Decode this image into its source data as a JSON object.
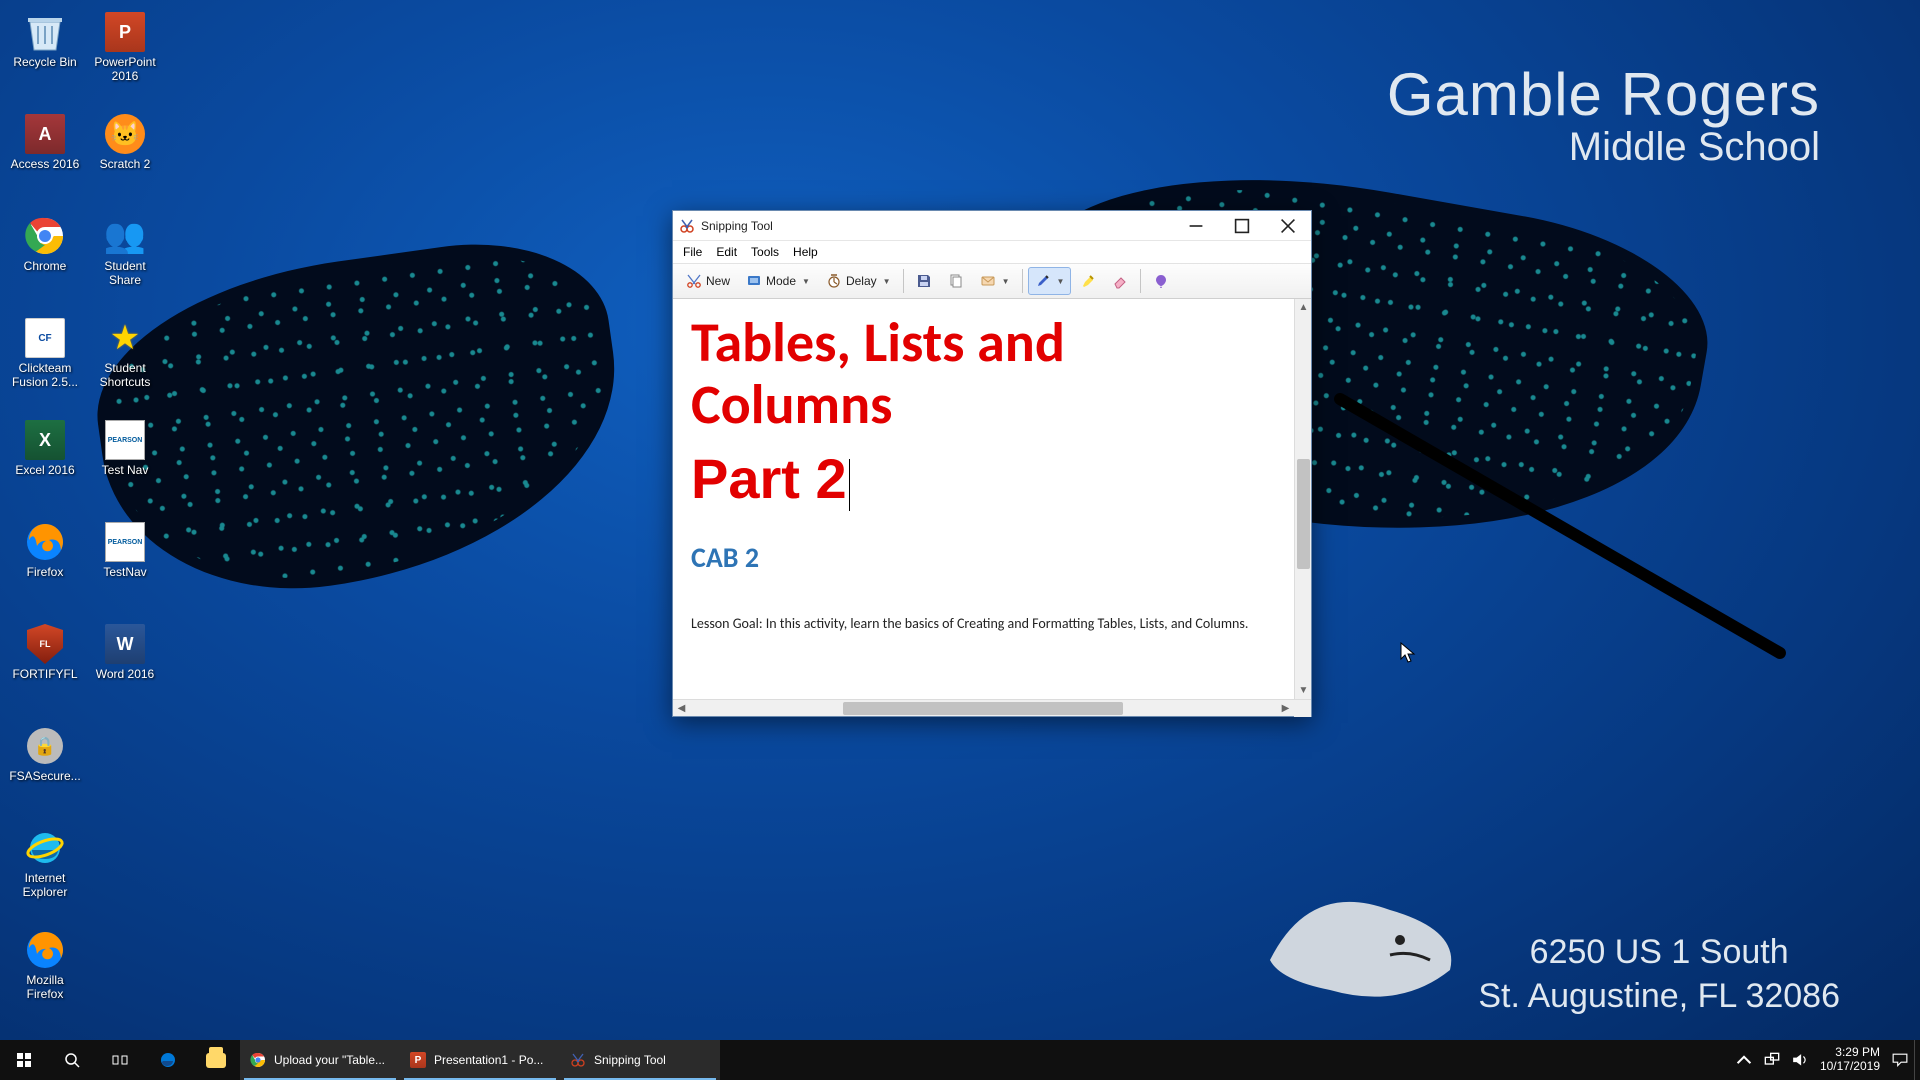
{
  "wallpaper": {
    "title_line1": "Gamble Rogers",
    "title_line2": "Middle School",
    "address_line1": "6250 US 1 South",
    "address_line2": "St. Augustine, FL 32086"
  },
  "desktop_icons": [
    {
      "name": "recycle-bin",
      "label": "Recycle Bin"
    },
    {
      "name": "powerpoint-2016",
      "label": "PowerPoint 2016"
    },
    {
      "name": "access-2016",
      "label": "Access 2016"
    },
    {
      "name": "scratch-2",
      "label": "Scratch 2"
    },
    {
      "name": "chrome",
      "label": "Chrome"
    },
    {
      "name": "student-share",
      "label": "Student Share"
    },
    {
      "name": "clickteam-fusion",
      "label": "Clickteam Fusion 2.5..."
    },
    {
      "name": "student-shortcuts",
      "label": "Student Shortcuts"
    },
    {
      "name": "excel-2016",
      "label": "Excel 2016"
    },
    {
      "name": "pearson-testnav",
      "label": "Test Nav"
    },
    {
      "name": "firefox",
      "label": "Firefox"
    },
    {
      "name": "testnav",
      "label": "TestNav"
    },
    {
      "name": "fortifyfl",
      "label": "FORTIFYFL"
    },
    {
      "name": "word-2016",
      "label": "Word 2016"
    },
    {
      "name": "fsasecure",
      "label": "FSASecure..."
    },
    {
      "name": "blank1",
      "label": ""
    },
    {
      "name": "internet-explorer",
      "label": "Internet Explorer"
    },
    {
      "name": "blank2",
      "label": ""
    },
    {
      "name": "mozilla-firefox",
      "label": "Mozilla Firefox"
    }
  ],
  "window": {
    "title": "Snipping Tool",
    "menus": {
      "file": "File",
      "edit": "Edit",
      "tools": "Tools",
      "help": "Help"
    },
    "toolbar": {
      "new": "New",
      "mode": "Mode",
      "delay": "Delay"
    },
    "document": {
      "heading_a": "Tables, Lists and Columns",
      "heading_b": "Part 2",
      "subheading": "CAB 2",
      "body": "Lesson Goal:  In this activity, learn the basics of Creating and Formatting Tables, Lists, and Columns."
    }
  },
  "taskbar": {
    "apps": [
      {
        "name": "chrome",
        "label": "Upload your \"Table...",
        "active": true
      },
      {
        "name": "powerpoint",
        "label": "Presentation1 - Po...",
        "active": true
      },
      {
        "name": "snipping",
        "label": "Snipping Tool",
        "active": true
      }
    ],
    "clock_time": "3:29 PM",
    "clock_date": "10/17/2019"
  }
}
